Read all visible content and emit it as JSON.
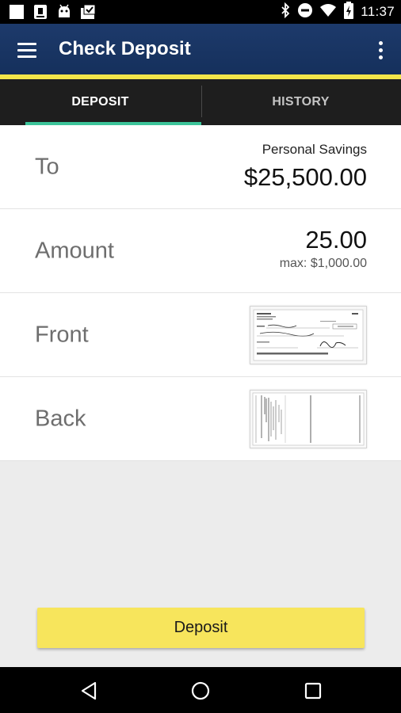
{
  "status_bar": {
    "time": "11:37",
    "left_icons": [
      "white-square-icon",
      "sim-card-icon",
      "android-icon",
      "photo-check-icon"
    ],
    "right_icons": [
      "bluetooth-icon",
      "do-not-disturb-icon",
      "wifi-icon",
      "battery-charging-icon"
    ]
  },
  "app_bar": {
    "title": "Check Deposit",
    "menu_icon": "hamburger-menu-icon",
    "overflow_icon": "more-vert-icon",
    "accent_color": "#f3e64a",
    "bar_color": "#1d3a6b"
  },
  "tabs": [
    {
      "label": "DEPOSIT",
      "selected": true
    },
    {
      "label": "HISTORY",
      "selected": false
    }
  ],
  "tab_indicator_color": "#3cc49a",
  "rows": {
    "to": {
      "label": "To",
      "account": "Personal Savings",
      "balance": "$25,500.00"
    },
    "amount": {
      "label": "Amount",
      "value": "25.00",
      "max": "max: $1,000.00"
    },
    "front": {
      "label": "Front",
      "image": "check-front-image"
    },
    "back": {
      "label": "Back",
      "image": "check-back-image"
    }
  },
  "deposit_button": {
    "label": "Deposit",
    "color": "#f7e55c"
  },
  "nav_bar": {
    "buttons": [
      "back-icon",
      "home-icon",
      "recents-icon"
    ]
  }
}
